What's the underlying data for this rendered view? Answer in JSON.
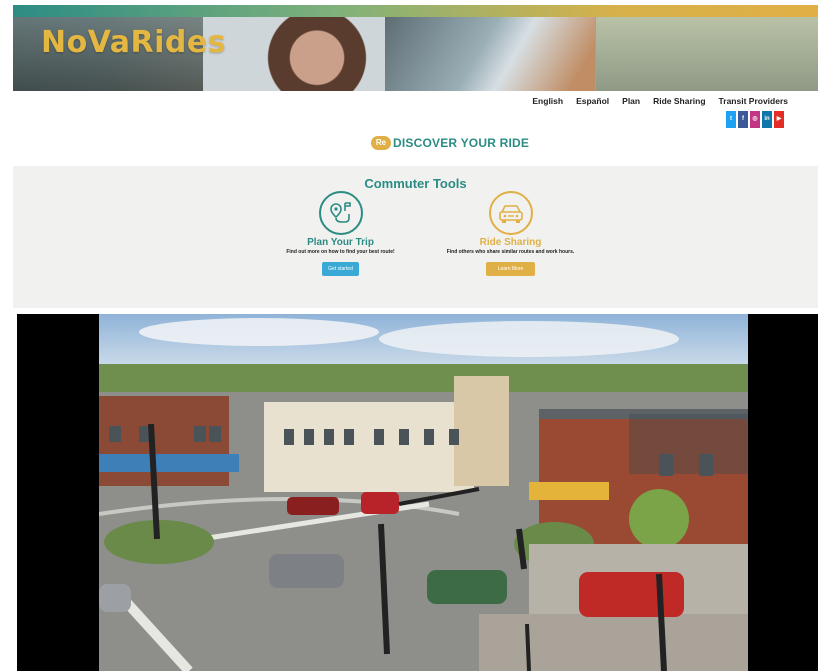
{
  "banner": {
    "logo_text": "NoVaRides"
  },
  "nav": {
    "items": [
      "English",
      "Español",
      "Plan",
      "Ride Sharing",
      "Transit Providers"
    ]
  },
  "social": [
    {
      "icon": "twitter-icon",
      "glyph": "t",
      "color": "#1da1f2"
    },
    {
      "icon": "facebook-icon",
      "glyph": "f",
      "color": "#3b5998"
    },
    {
      "icon": "instagram-icon",
      "glyph": "◎",
      "color": "#c13584"
    },
    {
      "icon": "linkedin-icon",
      "glyph": "in",
      "color": "#0e76a8"
    },
    {
      "icon": "youtube-icon",
      "glyph": "▶",
      "color": "#e52d27"
    }
  ],
  "rediscover": {
    "badge": "Re",
    "text": "DISCOVER YOUR RIDE"
  },
  "tools": {
    "title": "Commuter Tools",
    "items": [
      {
        "title": "Plan Your Trip",
        "description": "Find out more on how to find your best route!",
        "button": "Get started",
        "icon": "map-route-icon",
        "color": "#2b8c84",
        "button_color": "#3aa9d6"
      },
      {
        "title": "Ride Sharing",
        "description": "Find others who share similar routes and work hours.",
        "button": "Learn More",
        "icon": "car-icon",
        "color": "#e0b046",
        "button_color": "#e0b046"
      }
    ]
  }
}
